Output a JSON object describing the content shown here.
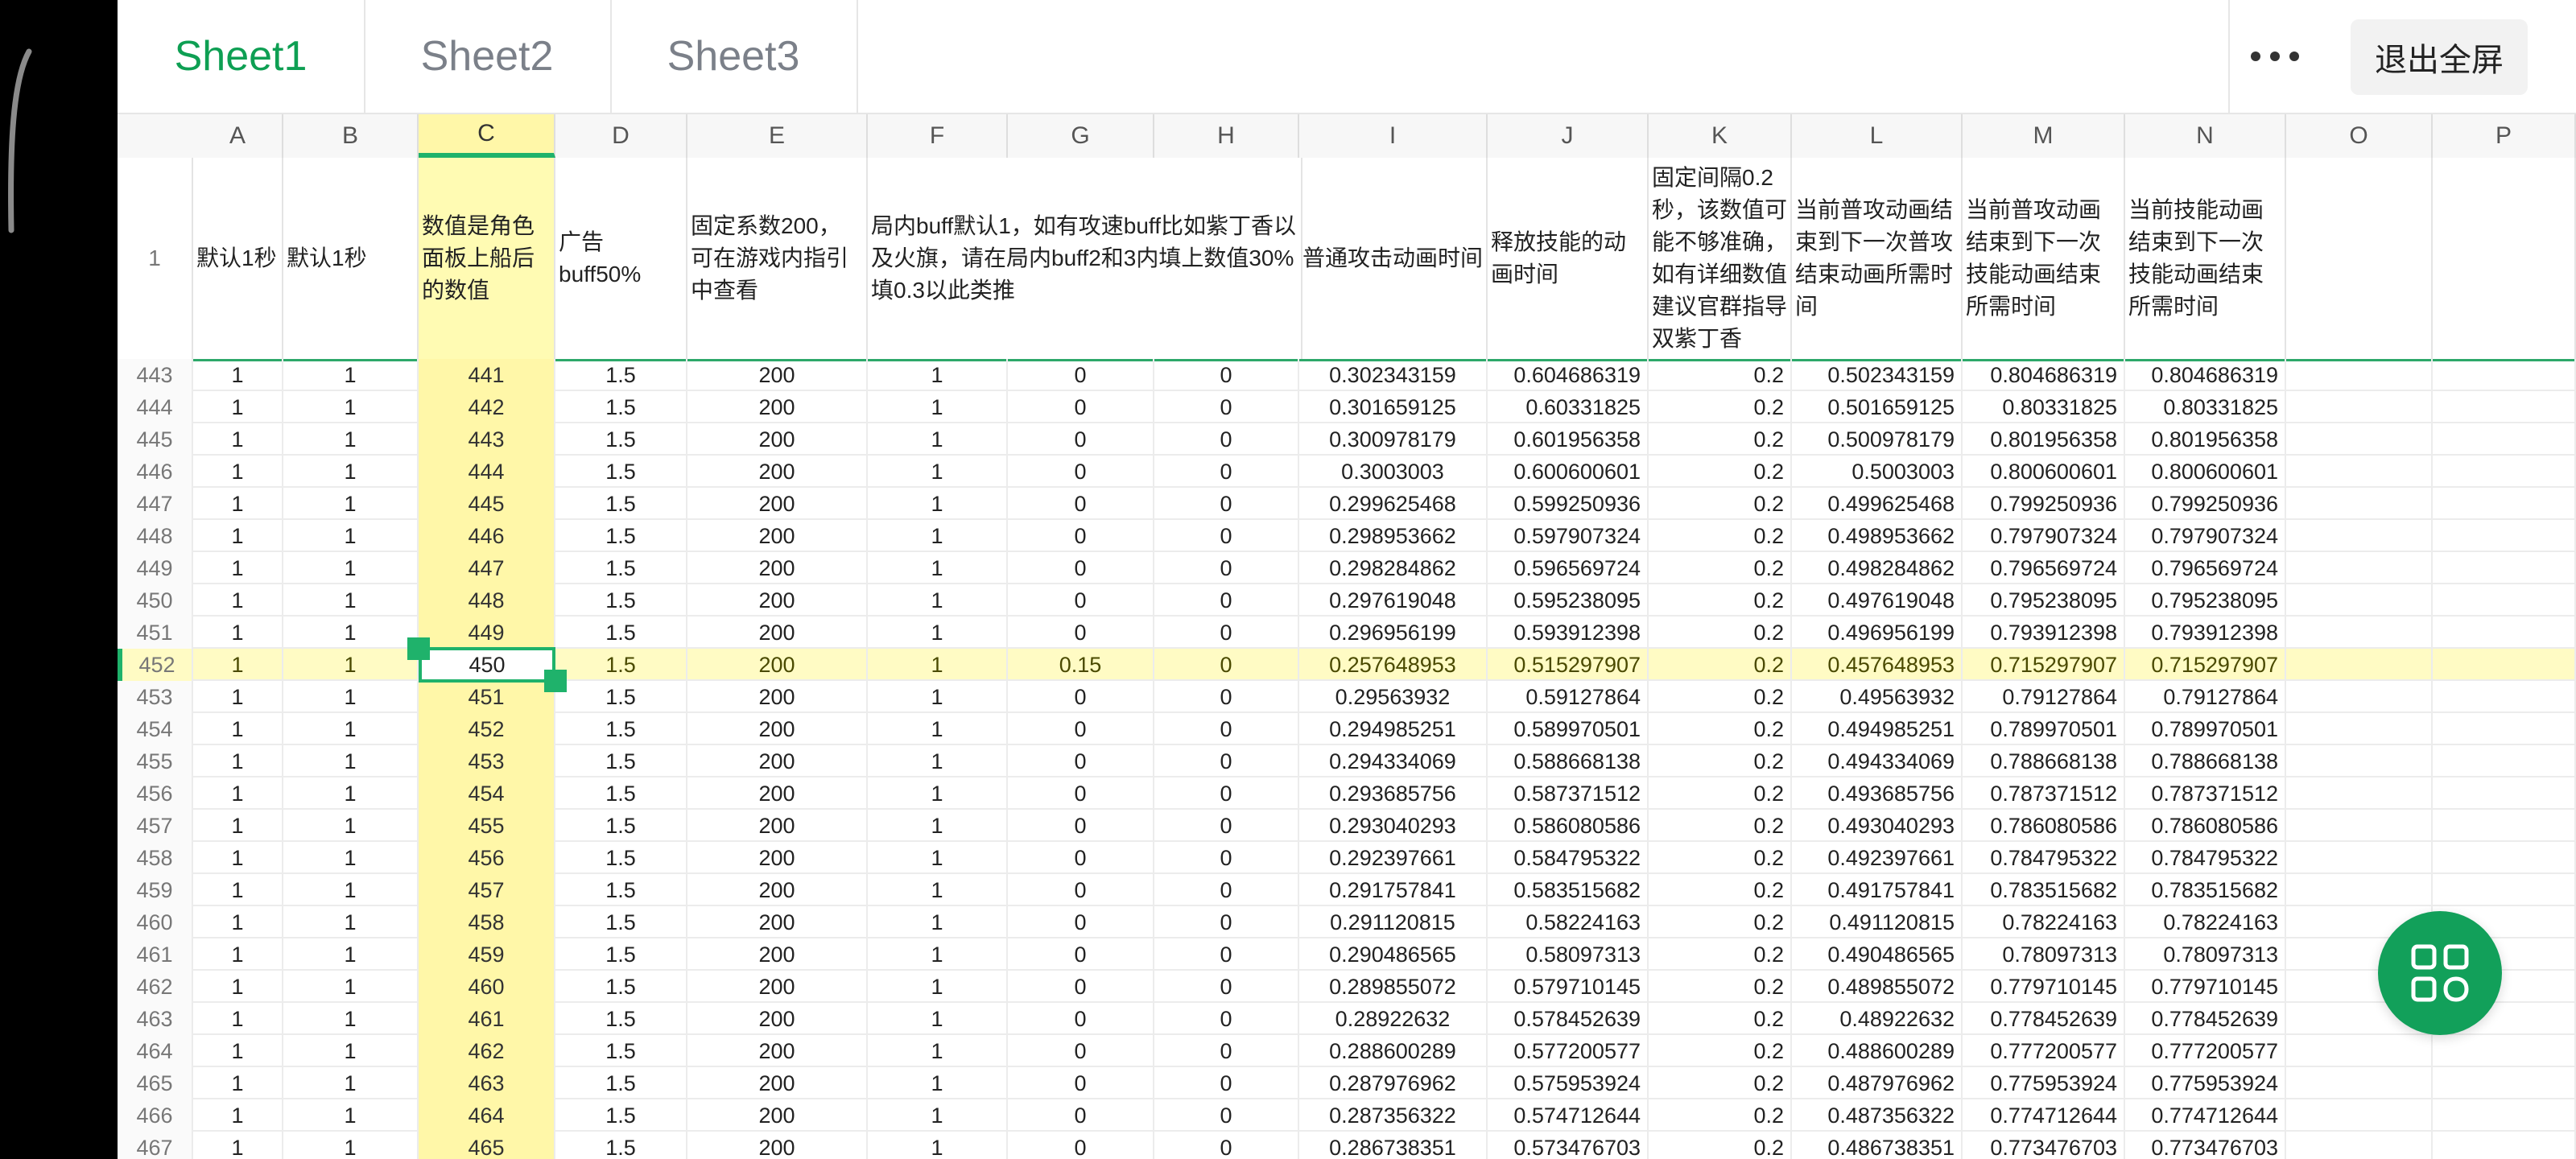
{
  "tabs": [
    "Sheet1",
    "Sheet2",
    "Sheet3"
  ],
  "active_tab_index": 0,
  "exit_fullscreen_label": "退出全屏",
  "accent_color": "#1fb26b",
  "highlight_color": "#fffbc4",
  "columns": [
    "A",
    "B",
    "C",
    "D",
    "E",
    "F",
    "G",
    "H",
    "I",
    "J",
    "K",
    "L",
    "M",
    "N",
    "O",
    "P"
  ],
  "header_row": {
    "number": "1",
    "cells": [
      "默认1秒",
      "默认1秒",
      "数值是角色面板上船后的数值",
      "广告buff50%",
      "固定系数200，可在游戏内指引中查看",
      "局内buff默认1，如有攻速buff比如紫丁香以及火旗，请在局内buff2和3内填上数值30%填0.3以此类推",
      "",
      "",
      "普通攻击动画时间",
      "释放技能的动画时间",
      "固定间隔0.2秒，该数值可能不够准确，如有详细数值建议官群指导双紫丁香",
      "当前普攻动画结束到下一次普攻结束动画所需时间",
      "当前普攻动画结束到下一次技能动画结束所需时间",
      "当前技能动画结束到下一次技能动画结束所需时间",
      "",
      ""
    ]
  },
  "rows": [
    {
      "n": "443",
      "c": [
        "1",
        "1",
        "441",
        "1.5",
        "200",
        "1",
        "0",
        "0",
        "0.302343159",
        "0.604686319",
        "0.2",
        "0.502343159",
        "0.804686319",
        "0.804686319",
        "",
        ""
      ]
    },
    {
      "n": "444",
      "c": [
        "1",
        "1",
        "442",
        "1.5",
        "200",
        "1",
        "0",
        "0",
        "0.301659125",
        "0.60331825",
        "0.2",
        "0.501659125",
        "0.80331825",
        "0.80331825",
        "",
        ""
      ]
    },
    {
      "n": "445",
      "c": [
        "1",
        "1",
        "443",
        "1.5",
        "200",
        "1",
        "0",
        "0",
        "0.300978179",
        "0.601956358",
        "0.2",
        "0.500978179",
        "0.801956358",
        "0.801956358",
        "",
        ""
      ]
    },
    {
      "n": "446",
      "c": [
        "1",
        "1",
        "444",
        "1.5",
        "200",
        "1",
        "0",
        "0",
        "0.3003003",
        "0.600600601",
        "0.2",
        "0.5003003",
        "0.800600601",
        "0.800600601",
        "",
        ""
      ]
    },
    {
      "n": "447",
      "c": [
        "1",
        "1",
        "445",
        "1.5",
        "200",
        "1",
        "0",
        "0",
        "0.299625468",
        "0.599250936",
        "0.2",
        "0.499625468",
        "0.799250936",
        "0.799250936",
        "",
        ""
      ]
    },
    {
      "n": "448",
      "c": [
        "1",
        "1",
        "446",
        "1.5",
        "200",
        "1",
        "0",
        "0",
        "0.298953662",
        "0.597907324",
        "0.2",
        "0.498953662",
        "0.797907324",
        "0.797907324",
        "",
        ""
      ]
    },
    {
      "n": "449",
      "c": [
        "1",
        "1",
        "447",
        "1.5",
        "200",
        "1",
        "0",
        "0",
        "0.298284862",
        "0.596569724",
        "0.2",
        "0.498284862",
        "0.796569724",
        "0.796569724",
        "",
        ""
      ]
    },
    {
      "n": "450",
      "c": [
        "1",
        "1",
        "448",
        "1.5",
        "200",
        "1",
        "0",
        "0",
        "0.297619048",
        "0.595238095",
        "0.2",
        "0.497619048",
        "0.795238095",
        "0.795238095",
        "",
        ""
      ]
    },
    {
      "n": "451",
      "c": [
        "1",
        "1",
        "449",
        "1.5",
        "200",
        "1",
        "0",
        "0",
        "0.296956199",
        "0.593912398",
        "0.2",
        "0.496956199",
        "0.793912398",
        "0.793912398",
        "",
        ""
      ]
    },
    {
      "n": "452",
      "c": [
        "1",
        "1",
        "450",
        "1.5",
        "200",
        "1",
        "0.15",
        "0",
        "0.257648953",
        "0.515297907",
        "0.2",
        "0.457648953",
        "0.715297907",
        "0.715297907",
        "",
        ""
      ]
    },
    {
      "n": "453",
      "c": [
        "1",
        "1",
        "451",
        "1.5",
        "200",
        "1",
        "0",
        "0",
        "0.29563932",
        "0.59127864",
        "0.2",
        "0.49563932",
        "0.79127864",
        "0.79127864",
        "",
        ""
      ]
    },
    {
      "n": "454",
      "c": [
        "1",
        "1",
        "452",
        "1.5",
        "200",
        "1",
        "0",
        "0",
        "0.294985251",
        "0.589970501",
        "0.2",
        "0.494985251",
        "0.789970501",
        "0.789970501",
        "",
        ""
      ]
    },
    {
      "n": "455",
      "c": [
        "1",
        "1",
        "453",
        "1.5",
        "200",
        "1",
        "0",
        "0",
        "0.294334069",
        "0.588668138",
        "0.2",
        "0.494334069",
        "0.788668138",
        "0.788668138",
        "",
        ""
      ]
    },
    {
      "n": "456",
      "c": [
        "1",
        "1",
        "454",
        "1.5",
        "200",
        "1",
        "0",
        "0",
        "0.293685756",
        "0.587371512",
        "0.2",
        "0.493685756",
        "0.787371512",
        "0.787371512",
        "",
        ""
      ]
    },
    {
      "n": "457",
      "c": [
        "1",
        "1",
        "455",
        "1.5",
        "200",
        "1",
        "0",
        "0",
        "0.293040293",
        "0.586080586",
        "0.2",
        "0.493040293",
        "0.786080586",
        "0.786080586",
        "",
        ""
      ]
    },
    {
      "n": "458",
      "c": [
        "1",
        "1",
        "456",
        "1.5",
        "200",
        "1",
        "0",
        "0",
        "0.292397661",
        "0.584795322",
        "0.2",
        "0.492397661",
        "0.784795322",
        "0.784795322",
        "",
        ""
      ]
    },
    {
      "n": "459",
      "c": [
        "1",
        "1",
        "457",
        "1.5",
        "200",
        "1",
        "0",
        "0",
        "0.291757841",
        "0.583515682",
        "0.2",
        "0.491757841",
        "0.783515682",
        "0.783515682",
        "",
        ""
      ]
    },
    {
      "n": "460",
      "c": [
        "1",
        "1",
        "458",
        "1.5",
        "200",
        "1",
        "0",
        "0",
        "0.291120815",
        "0.58224163",
        "0.2",
        "0.491120815",
        "0.78224163",
        "0.78224163",
        "",
        ""
      ]
    },
    {
      "n": "461",
      "c": [
        "1",
        "1",
        "459",
        "1.5",
        "200",
        "1",
        "0",
        "0",
        "0.290486565",
        "0.58097313",
        "0.2",
        "0.490486565",
        "0.78097313",
        "0.78097313",
        "",
        ""
      ]
    },
    {
      "n": "462",
      "c": [
        "1",
        "1",
        "460",
        "1.5",
        "200",
        "1",
        "0",
        "0",
        "0.289855072",
        "0.579710145",
        "0.2",
        "0.489855072",
        "0.779710145",
        "0.779710145",
        "",
        ""
      ]
    },
    {
      "n": "463",
      "c": [
        "1",
        "1",
        "461",
        "1.5",
        "200",
        "1",
        "0",
        "0",
        "0.28922632",
        "0.578452639",
        "0.2",
        "0.48922632",
        "0.778452639",
        "0.778452639",
        "",
        ""
      ]
    },
    {
      "n": "464",
      "c": [
        "1",
        "1",
        "462",
        "1.5",
        "200",
        "1",
        "0",
        "0",
        "0.288600289",
        "0.577200577",
        "0.2",
        "0.488600289",
        "0.777200577",
        "0.777200577",
        "",
        ""
      ]
    },
    {
      "n": "465",
      "c": [
        "1",
        "1",
        "463",
        "1.5",
        "200",
        "1",
        "0",
        "0",
        "0.287976962",
        "0.575953924",
        "0.2",
        "0.487976962",
        "0.775953924",
        "0.775953924",
        "",
        ""
      ]
    },
    {
      "n": "466",
      "c": [
        "1",
        "1",
        "464",
        "1.5",
        "200",
        "1",
        "0",
        "0",
        "0.287356322",
        "0.574712644",
        "0.2",
        "0.487356322",
        "0.774712644",
        "0.774712644",
        "",
        ""
      ]
    },
    {
      "n": "467",
      "c": [
        "1",
        "1",
        "465",
        "1.5",
        "200",
        "1",
        "0",
        "0",
        "0.286738351",
        "0.573476703",
        "0.2",
        "0.486738351",
        "0.773476703",
        "0.773476703",
        "",
        ""
      ]
    }
  ],
  "selected_column": "C",
  "selected_row": "452",
  "fab_icon": "apps-grid-icon"
}
